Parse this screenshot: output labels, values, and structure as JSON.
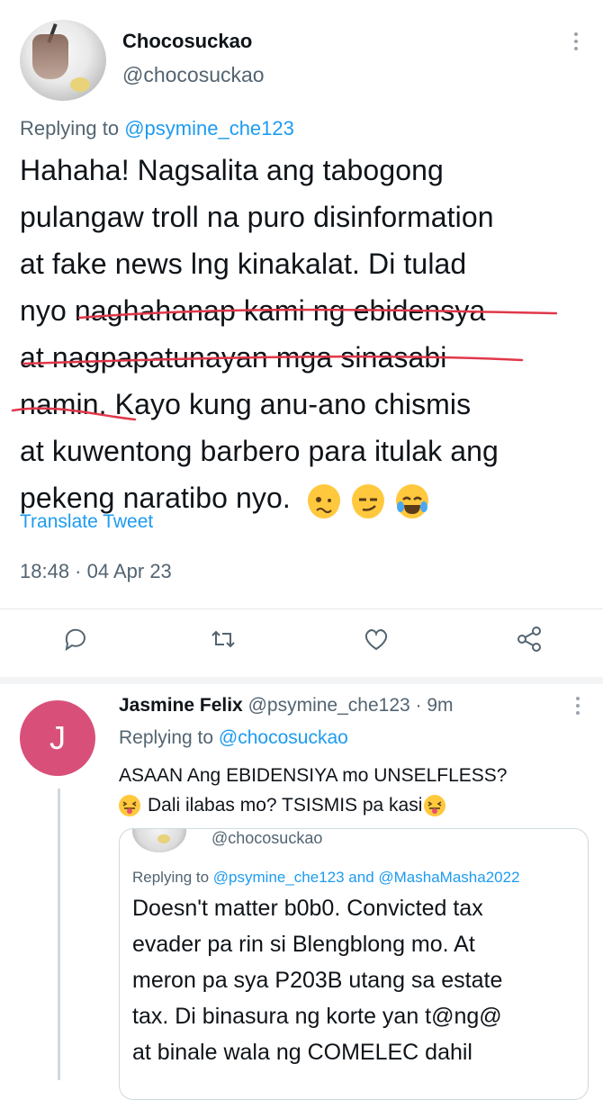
{
  "main_tweet": {
    "display_name": "Chocosuckao",
    "handle": "@chocosuckao",
    "replying_prefix": "Replying to",
    "replying_to": "@psymine_che123",
    "body_lines": [
      "Hahaha! Nagsalita ang tabogong",
      "pulangaw troll na puro disinformation",
      "at fake news lng kinakalat. Di tulad",
      "nyo naghahanap kami ng ebidensya",
      "at nagpapatunayan mga sinasabi",
      "namin. Kayo kung anu-ano chismis",
      "at kuwentong barbero para itulak ang",
      "pekeng naratibo nyo."
    ],
    "translate_label": "Translate Tweet",
    "timestamp": "18:48 · 04 Apr 23",
    "actions": [
      "reply-icon",
      "retweet-icon",
      "like-icon",
      "share-icon"
    ]
  },
  "reply_tweet": {
    "avatar_letter": "J",
    "display_name": "Jasmine Felix",
    "handle_time": "@psymine_che123 · 9m",
    "replying_prefix": "Replying to",
    "replying_to": "@chocosuckao",
    "line1": "ASAAN Ang EBIDENSIYA mo UNSELFLESS?",
    "line2": "Dali ilabas mo? TSISMIS pa kasi",
    "avatar_color": "#d8507a"
  },
  "quoted_tweet": {
    "handle": "@chocosuckao",
    "replying_prefix": "Replying to",
    "replying_to": "@psymine_che123 and @MashaMasha2022",
    "lines": [
      "Doesn't matter b0b0. Convicted tax",
      "evader pa rin si Blengblong mo. At",
      "meron pa sya P203B utang sa estate",
      "tax. Di binasura ng korte yan t@ng@",
      "at binale wala ng COMELEC dahil"
    ]
  },
  "colors": {
    "link": "#1d9bf0",
    "secondary": "#536471",
    "underline_marker": "#e0384a"
  }
}
